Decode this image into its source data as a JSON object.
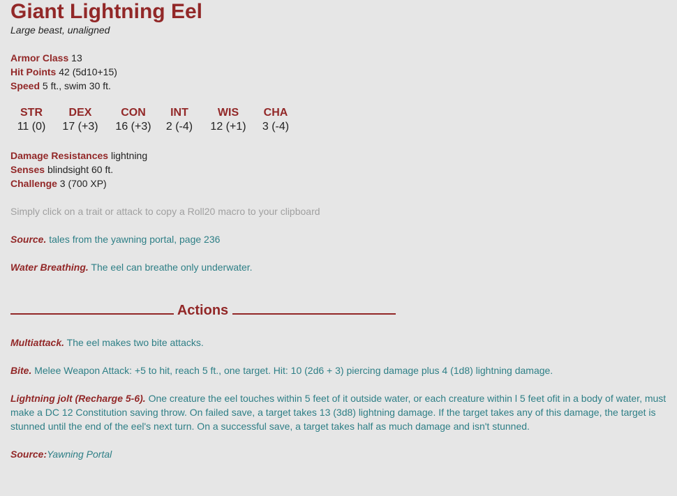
{
  "monster": {
    "name": "Giant Lightning Eel",
    "type_line": "Large beast, unaligned"
  },
  "stats": {
    "armor_class_label": "Armor Class",
    "armor_class_value": "13",
    "hit_points_label": "Hit Points",
    "hit_points_value": "42 (5d10+15)",
    "speed_label": "Speed",
    "speed_value": "5 ft., swim 30 ft."
  },
  "abilities": [
    {
      "name": "STR",
      "score": "11 (0)"
    },
    {
      "name": "DEX",
      "score": "17 (+3)"
    },
    {
      "name": "CON",
      "score": "16 (+3)"
    },
    {
      "name": "INT",
      "score": "2 (-4)"
    },
    {
      "name": "WIS",
      "score": "12 (+1)"
    },
    {
      "name": "CHA",
      "score": "3 (-4)"
    }
  ],
  "details": {
    "damage_resistances_label": "Damage Resistances",
    "damage_resistances_value": "lightning",
    "senses_label": "Senses",
    "senses_value": "blindsight 60 ft.",
    "challenge_label": "Challenge",
    "challenge_value": "3 (700 XP)"
  },
  "hint": "Simply click on a trait or attack to copy a Roll20 macro to your clipboard",
  "traits": [
    {
      "name": "Source.",
      "text": "tales from the yawning portal, page 236"
    },
    {
      "name": "Water Breathing.",
      "text": "The eel can breathe only underwater."
    }
  ],
  "actions_header": "Actions",
  "actions": [
    {
      "name": "Multiattack.",
      "text": "The eel makes two bite attacks."
    },
    {
      "name": "Bite.",
      "text": "Melee Weapon Attack: +5 to hit, reach 5 ft., one target. Hit: 10 (2d6 + 3) piercing damage plus 4 (1d8) lightning damage."
    },
    {
      "name": "Lightning jolt (Recharge 5-6).",
      "text": "One creature the eel touches within 5 feet of it outside water, or each creature within l 5 feet ofit in a body of water, must make a DC 12 Constitution saving throw. On failed save, a target takes 13 (3d8) lightning damage. If the target takes any of this damage, the target is stunned until the end of the eel's next turn. On a successful save, a target takes half as much damage and isn't stunned."
    }
  ],
  "source_footer": {
    "label": "Source:",
    "value": "Yawning Portal"
  }
}
